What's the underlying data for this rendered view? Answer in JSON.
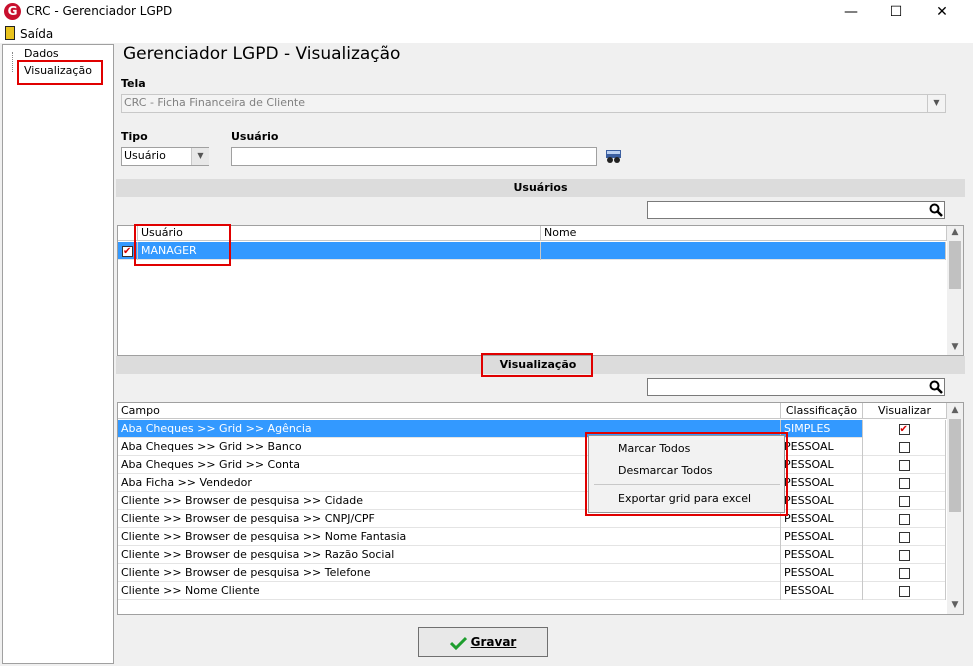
{
  "window": {
    "title": "CRC - Gerenciador LGPD",
    "app_icon_letter": "G",
    "minimize_glyph": "—",
    "maximize_glyph": "☐",
    "close_glyph": "✕"
  },
  "menu": {
    "exit_label": "Saída"
  },
  "tree": {
    "items": [
      {
        "label": "Dados"
      },
      {
        "label": "Visualização",
        "selected": true
      }
    ]
  },
  "main": {
    "heading": "Gerenciador LGPD - Visualização",
    "tela_label": "Tela",
    "tela_value": "CRC - Ficha Financeira de Cliente",
    "tipo_label": "Tipo",
    "tipo_value": "Usuário",
    "usuario_label": "Usuário",
    "usuario_value": ""
  },
  "users_section": {
    "title": "Usuários",
    "search_value": "",
    "columns": [
      "Usuário",
      "Nome"
    ],
    "rows": [
      {
        "usuario": "MANAGER",
        "nome": "",
        "checked": true,
        "selected": true
      }
    ]
  },
  "view_section": {
    "title": "Visualização",
    "search_value": "",
    "columns": [
      "Campo",
      "Classificação",
      "Visualizar"
    ],
    "rows": [
      {
        "campo": "Aba Cheques >> Grid >> Agência",
        "classificacao": "SIMPLES",
        "visualizar": true,
        "selected": true
      },
      {
        "campo": "Aba Cheques >> Grid >> Banco",
        "classificacao": "PESSOAL",
        "visualizar": false
      },
      {
        "campo": "Aba Cheques >> Grid >> Conta",
        "classificacao": "PESSOAL",
        "visualizar": false
      },
      {
        "campo": "Aba Ficha >> Vendedor",
        "classificacao": "PESSOAL",
        "visualizar": false
      },
      {
        "campo": "Cliente >> Browser de pesquisa >> Cidade",
        "classificacao": "PESSOAL",
        "visualizar": false
      },
      {
        "campo": "Cliente >> Browser de pesquisa >> CNPJ/CPF",
        "classificacao": "PESSOAL",
        "visualizar": false
      },
      {
        "campo": "Cliente >> Browser de pesquisa >> Nome Fantasia",
        "classificacao": "PESSOAL",
        "visualizar": false
      },
      {
        "campo": "Cliente >> Browser de pesquisa >> Razão Social",
        "classificacao": "PESSOAL",
        "visualizar": false
      },
      {
        "campo": "Cliente >> Browser de pesquisa >> Telefone",
        "classificacao": "PESSOAL",
        "visualizar": false
      },
      {
        "campo": "Cliente >> Nome Cliente",
        "classificacao": "PESSOAL",
        "visualizar": false
      }
    ]
  },
  "context_menu": {
    "items": [
      {
        "label": "Marcar Todos"
      },
      {
        "label": "Desmarcar Todos"
      },
      {
        "label": "Exportar grid para excel"
      }
    ]
  },
  "footer": {
    "save_label": "Gravar"
  },
  "colors": {
    "highlight_red": "#e00000",
    "selection_blue": "#3399ff",
    "check_red": "#d40000",
    "save_green": "#1e9e2e"
  },
  "icons": [
    "app-logo-icon",
    "exit-door-icon",
    "binoculars-search-icon",
    "magnifier-icon",
    "checkmark-icon"
  ]
}
